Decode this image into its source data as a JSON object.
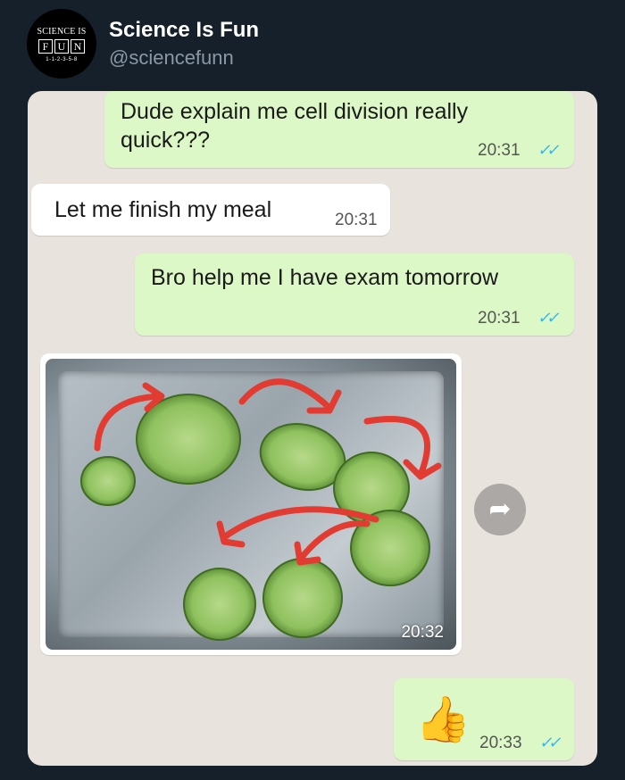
{
  "account": {
    "name": "Science Is Fun",
    "handle": "@sciencefunn",
    "avatar_line1": "SCIENCE IS",
    "avatar_letters": [
      "F",
      "U",
      "N"
    ],
    "avatar_line3": "1-1-2-3-5-8"
  },
  "messages": [
    {
      "direction": "outgoing",
      "text_lines": [
        "Dude explain me cell division really",
        "quick???"
      ],
      "time": "20:31",
      "read": "✓✓"
    },
    {
      "direction": "incoming",
      "text_lines": [
        "Let me finish my meal"
      ],
      "time": "20:31"
    },
    {
      "direction": "outgoing",
      "text_lines": [
        "Bro help me I have exam tomorrow"
      ],
      "time": "20:31",
      "read": "✓✓"
    },
    {
      "direction": "incoming",
      "type": "image",
      "time": "20:32"
    },
    {
      "direction": "outgoing",
      "emoji": "👍",
      "time": "20:33",
      "read": "✓✓"
    }
  ],
  "icons": {
    "share": "share-forward-icon",
    "read": "double-check-icon"
  },
  "colors": {
    "outgoing_bubble": "#dcf8c6",
    "incoming_bubble": "#ffffff",
    "read_ticks": "#34b7f1",
    "background": "#15202b"
  }
}
